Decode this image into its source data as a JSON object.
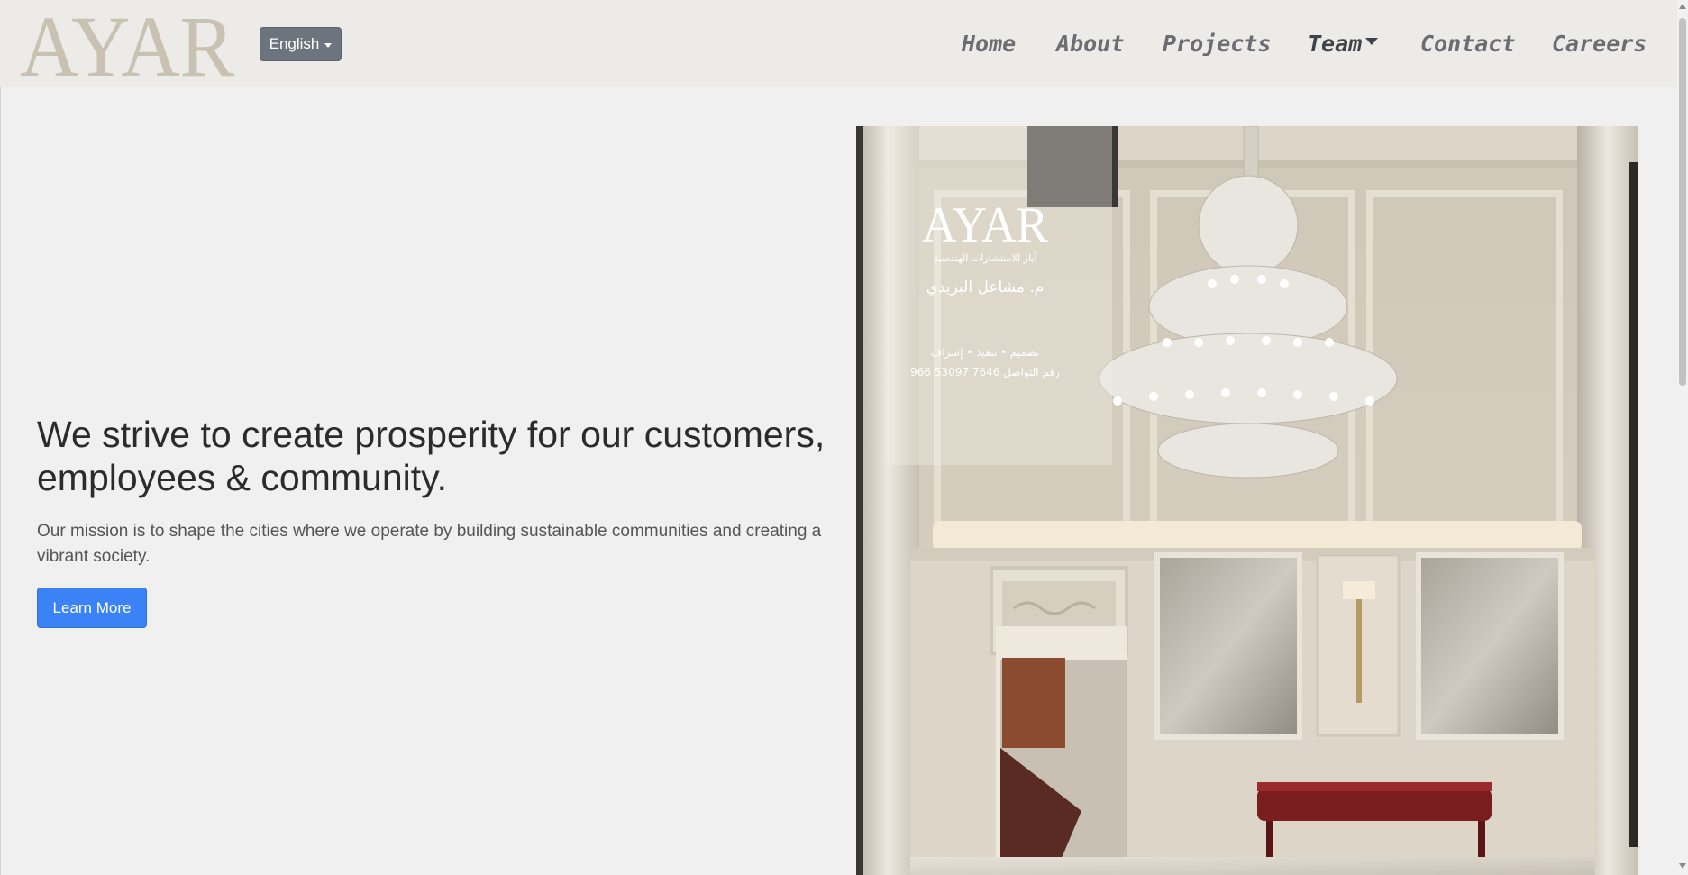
{
  "brand": {
    "logo_text": "AYAR",
    "logo_color": "#c9c2b2"
  },
  "language": {
    "label": "English"
  },
  "nav": {
    "items": [
      {
        "label": "Home"
      },
      {
        "label": "About"
      },
      {
        "label": "Projects"
      },
      {
        "label": "Team"
      },
      {
        "label": "Contact"
      },
      {
        "label": "Careers"
      }
    ]
  },
  "hero": {
    "title": "We strive to create prosperity for our customers, employees & community.",
    "text": "Our mission is to shape the cities where we operate by building sustainable communities and creating a vibrant society.",
    "button": "Learn More"
  },
  "hero_image": {
    "card_logo": "AYAR",
    "card_line1": "آيار للاستشارات الهندسية",
    "card_line2": "م. مشاعل البريدي",
    "card_line3": "تصميم • تنفيذ • إشراف",
    "card_line4": "رقم التواصل 7646 53097 966"
  },
  "colors": {
    "accent": "#3b82f6",
    "lang_button": "#6c757d",
    "navbar_bg": "#ecebe7"
  }
}
